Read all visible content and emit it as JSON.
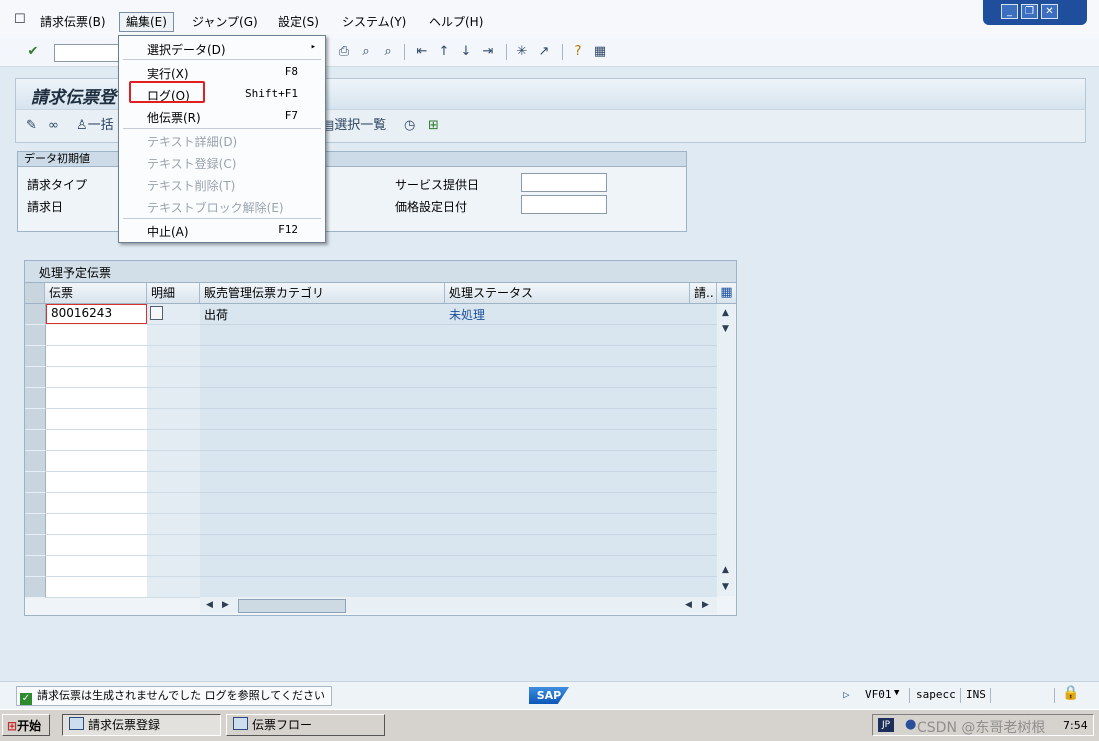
{
  "menubar": {
    "items": [
      {
        "label": "請求伝票(B)"
      },
      {
        "label": "編集(E)"
      },
      {
        "label": "ジャンプ(G)"
      },
      {
        "label": "設定(S)"
      },
      {
        "label": "システム(Y)"
      },
      {
        "label": "ヘルプ(H)"
      }
    ]
  },
  "window_controls": {
    "minimize": "_",
    "restore": "❐",
    "close": "✕"
  },
  "page": {
    "title": "請求伝票登"
  },
  "app_toolbar": {
    "bulk_label": "一括",
    "selection_list": "選択一覧"
  },
  "group": {
    "title": "データ初期値",
    "invoice_type_label": "請求タイプ",
    "invoice_date_label": "請求日",
    "service_date_label": "サービス提供日",
    "pricing_date_label": "価格設定日付",
    "service_date_value": "",
    "pricing_date_value": ""
  },
  "table": {
    "title": "処理予定伝票",
    "columns": [
      "伝票",
      "明細",
      "販売管理伝票カテゴリ",
      "処理ステータス",
      "請.."
    ],
    "rows": [
      {
        "doc": "80016243",
        "category": "出荷",
        "status": "未処理"
      }
    ]
  },
  "dropdown": {
    "items": [
      {
        "label": "選択データ(D)",
        "shortcut": "▸",
        "enabled": true
      },
      {
        "label": "実行(X)",
        "shortcut": "F8",
        "enabled": true
      },
      {
        "label": "ログ(O)",
        "shortcut": "Shift+F1",
        "enabled": true
      },
      {
        "label": "他伝票(R)",
        "shortcut": "F7",
        "enabled": true
      },
      {
        "label": "テキスト詳細(D)",
        "shortcut": "",
        "enabled": false
      },
      {
        "label": "テキスト登録(C)",
        "shortcut": "",
        "enabled": false
      },
      {
        "label": "テキスト削除(T)",
        "shortcut": "",
        "enabled": false
      },
      {
        "label": "テキストブロック解除(E)",
        "shortcut": "",
        "enabled": false
      },
      {
        "label": "中止(A)",
        "shortcut": "F12",
        "enabled": true
      }
    ]
  },
  "status": {
    "message": "請求伝票は生成されませんでした  ログを参照してください",
    "logo": "SAP",
    "transaction": "VF01",
    "system": "sapecc",
    "mode": "INS"
  },
  "taskbar": {
    "start": "开始",
    "task1": "請求伝票登録",
    "task2": "伝票フロー",
    "tray_lang": "JP",
    "tray_watermark": "CSDN @东哥老树根",
    "clock": "7:54"
  },
  "colors": {
    "accent": "#1e4e9c",
    "highlight": "#e02020",
    "status_text": "#1a4f9c"
  }
}
